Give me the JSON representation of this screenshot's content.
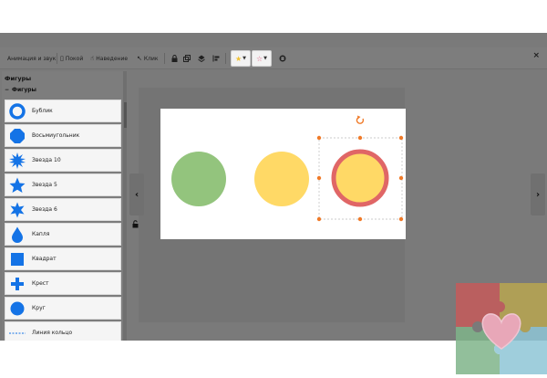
{
  "toolbar": {
    "anim_label": "Анимация и звук",
    "rest_label": "Покой",
    "hover_label": "Наведение",
    "click_label": "Клик",
    "close_label": "×"
  },
  "panel": {
    "title": "Фигуры",
    "section_label": "Фигуры",
    "section_toggle": "−",
    "items": [
      {
        "label": "Бублик",
        "icon": "donut-icon"
      },
      {
        "label": "Восьмиугольник",
        "icon": "octagon-icon"
      },
      {
        "label": "Звезда 10",
        "icon": "star10-icon"
      },
      {
        "label": "Звезда 5",
        "icon": "star5-icon"
      },
      {
        "label": "Звезда 6",
        "icon": "star6-icon"
      },
      {
        "label": "Капля",
        "icon": "drop-icon"
      },
      {
        "label": "Квадрат",
        "icon": "square-icon"
      },
      {
        "label": "Крест",
        "icon": "cross-icon"
      },
      {
        "label": "Круг",
        "icon": "circle-icon"
      },
      {
        "label": "Линия кольцо",
        "icon": "line-ring-icon"
      }
    ]
  },
  "colors": {
    "accent": "#1473e6",
    "green_circle": "#93c47d",
    "yellow_circle": "#ffd966",
    "ring_stroke": "#e06666",
    "handle": "#f07a28"
  }
}
